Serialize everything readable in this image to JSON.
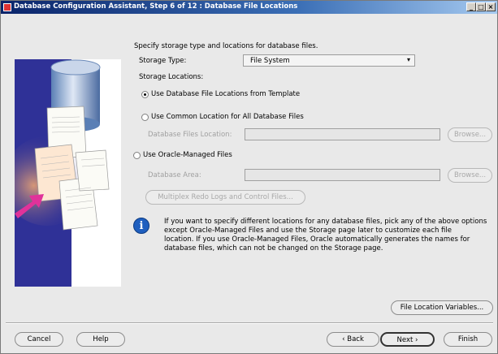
{
  "window": {
    "title": "Database Configuration Assistant, Step 6 of 12 : Database File Locations",
    "controls": [
      "_",
      "□",
      "×"
    ]
  },
  "main": {
    "instruction": "Specify storage type and locations for database files.",
    "storage_type_label": "Storage Type:",
    "storage_type_value": "File System",
    "storage_locations_label": "Storage Locations:",
    "options": [
      {
        "label": "Use Database File Locations from Template",
        "selected": true
      },
      {
        "label": "Use Common Location for All Database Files",
        "selected": false
      },
      {
        "label": "Use Oracle-Managed Files",
        "selected": false
      }
    ],
    "files_location_label": "Database Files Location:",
    "files_location_value": "",
    "browse_label_1": "Browse...",
    "database_area_label": "Database Area:",
    "database_area_value": "",
    "browse_label_2": "Browse...",
    "multiplex_label": "Multiplex Redo Logs and Control Files...",
    "info_icon": "info-icon",
    "info_lines": [
      "If you want to specify different locations for any database files, pick any of the above options",
      "except Oracle-Managed Files and use the Storage page later to customize each file",
      "location. If you use Oracle-Managed Files, Oracle automatically generates the names for",
      "database files, which can not be changed on the Storage page."
    ],
    "file_location_variables_label": "File Location Variables..."
  },
  "footer": {
    "cancel_label": "Cancel",
    "help_label": "Help",
    "back_label": "Back",
    "next_label": "Next",
    "finish_label": "Finish"
  },
  "colors": {
    "title_gradient_start": "#0a246a",
    "left_panel": "#2f3197",
    "arrow_accent": "#e0329a"
  }
}
